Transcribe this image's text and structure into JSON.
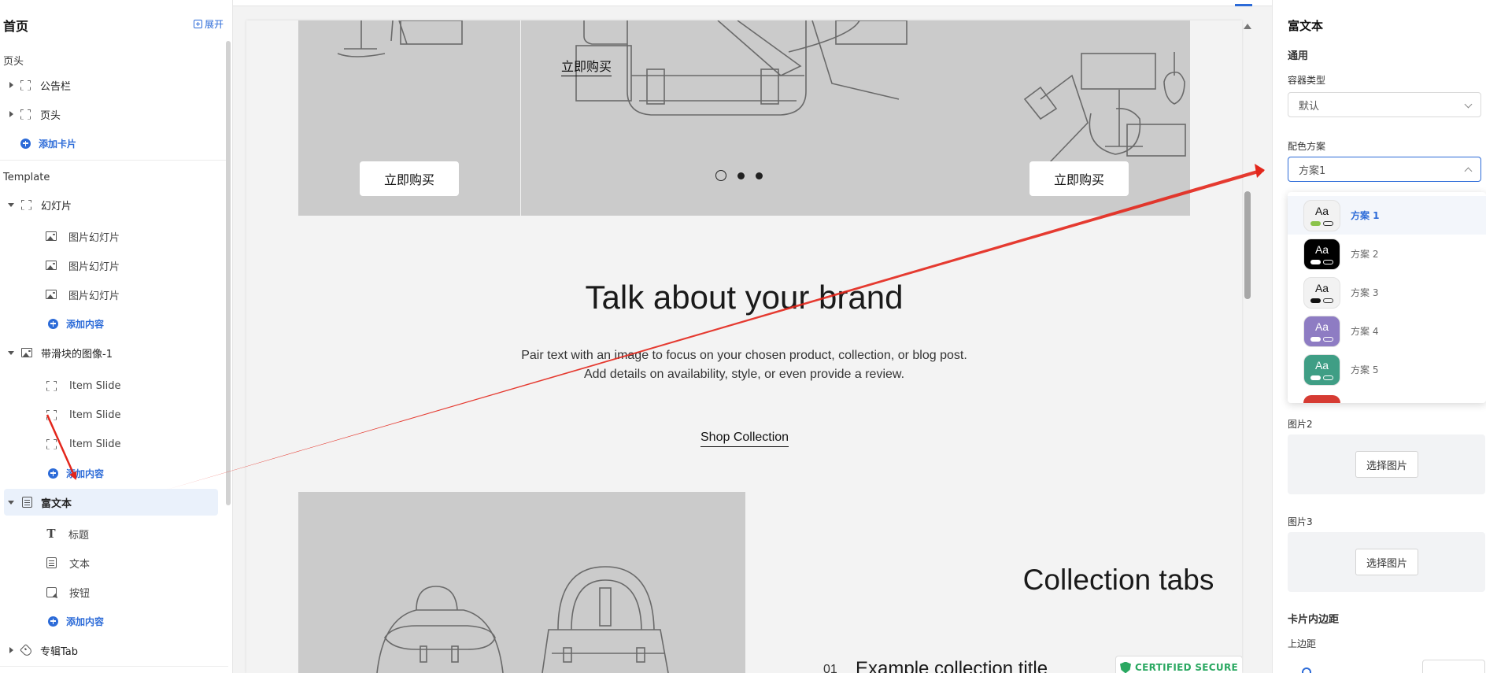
{
  "sidebar": {
    "title": "首页",
    "expand_label": "展开",
    "header_section": "页头",
    "header_items": [
      "公告栏",
      "页头"
    ],
    "add_card": "添加卡片",
    "template_section": "Template",
    "slideshow": {
      "label": "幻灯片",
      "children": [
        "图片幻灯片",
        "图片幻灯片",
        "图片幻灯片"
      ],
      "add": "添加内容"
    },
    "image_slider": {
      "label": "带滑块的图像-1",
      "children": [
        "Item Slide",
        "Item Slide",
        "Item Slide"
      ],
      "add": "添加内容"
    },
    "rich_text": {
      "label": "富文本",
      "children": [
        "标题",
        "文本",
        "按钮"
      ],
      "add": "添加内容"
    },
    "collection_tab": "专辑Tab"
  },
  "preview": {
    "slide_link": "立即购买",
    "slide_btn_left": "立即购买",
    "slide_btn_right": "立即购买",
    "brand_title": "Talk about your brand",
    "brand_text_line1": "Pair text with an image to focus on your chosen product, collection, or blog post.",
    "brand_text_line2": "Add details on availability, style, or even provide a review.",
    "shop_link": "Shop Collection",
    "collection_title": "Collection tabs",
    "collection_item_number": "01",
    "collection_item_title": "Example collection title",
    "certified_badge": "CERTIFIED SECURE"
  },
  "panel": {
    "title": "富文本",
    "general": "通用",
    "container_type_label": "容器类型",
    "container_type_value": "默认",
    "color_scheme_label": "配色方案",
    "color_scheme_value": "方案1",
    "schemes": [
      {
        "label": "方案 1",
        "bg": "#f2f2f2",
        "fg": "#111111",
        "pill": "#8bc34a"
      },
      {
        "label": "方案 2",
        "bg": "#000000",
        "fg": "#ffffff",
        "pill": "#ffffff"
      },
      {
        "label": "方案 3",
        "bg": "#f2f2f2",
        "fg": "#111111",
        "pill": "#111111"
      },
      {
        "label": "方案 4",
        "bg": "#8e7cc3",
        "fg": "#ffffff",
        "pill": "#ffffff"
      },
      {
        "label": "方案 5",
        "bg": "#3f9e85",
        "fg": "#ffffff",
        "pill": "#ffffff"
      }
    ],
    "image2_label": "图片2",
    "image3_label": "图片3",
    "choose_image": "选择图片",
    "padding_section": "卡片内边距",
    "top_padding_label": "上边距"
  },
  "colors": {
    "accent": "#2c6bd8",
    "annotation_arrow": "#e3261b"
  }
}
